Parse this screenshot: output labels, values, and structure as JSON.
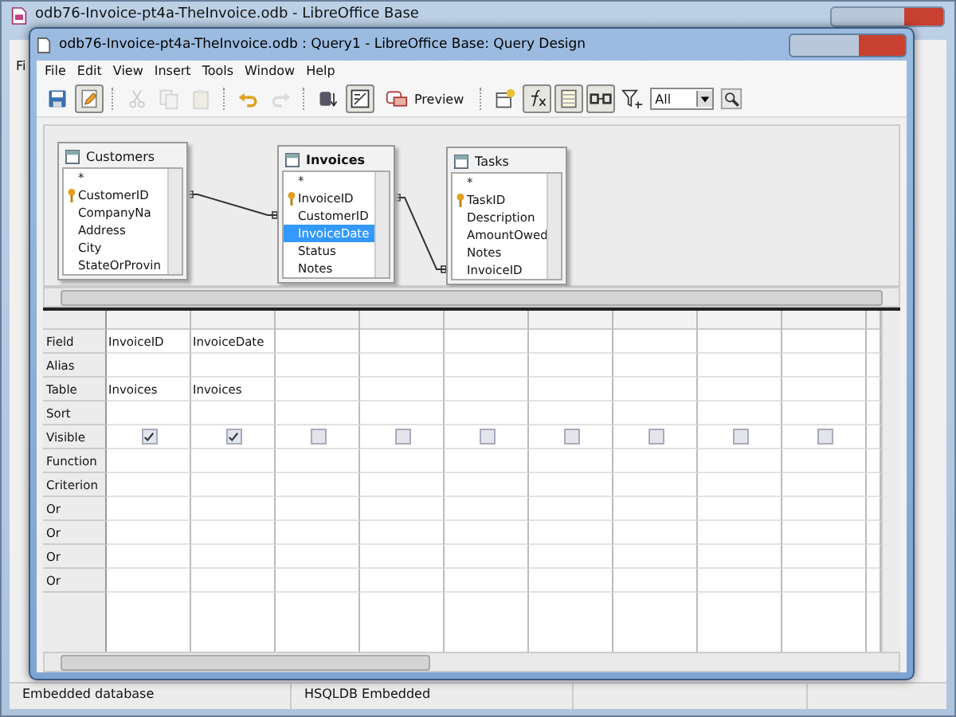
{
  "background_window": {
    "title": "odb76-Invoice-pt4a-TheInvoice.odb - LibreOffice Base",
    "menu_fragment": "Fi"
  },
  "window": {
    "title": "odb76-Invoice-pt4a-TheInvoice.odb : Query1 - LibreOffice Base: Query Design"
  },
  "menu": [
    "File",
    "Edit",
    "View",
    "Insert",
    "Tools",
    "Window",
    "Help"
  ],
  "toolbar": [
    {
      "kind": "icon",
      "pressed": false,
      "disabled": false
    },
    {
      "kind": "icon",
      "pressed": true,
      "disabled": false
    },
    {
      "kind": "separator"
    },
    {
      "kind": "icon",
      "pressed": false,
      "disabled": true
    },
    {
      "kind": "icon",
      "pressed": false,
      "disabled": true
    },
    {
      "kind": "icon",
      "pressed": false,
      "disabled": true
    },
    {
      "kind": "separator"
    },
    {
      "kind": "icon",
      "pressed": false,
      "disabled": false
    },
    {
      "kind": "icon",
      "pressed": false,
      "disabled": true
    },
    {
      "kind": "separator"
    },
    {
      "kind": "icon",
      "pressed": false,
      "disabled": false
    },
    {
      "kind": "icon",
      "pressed": true,
      "disabled": false
    },
    {
      "kind": "text_button",
      "label": "Preview"
    },
    {
      "kind": "separator"
    },
    {
      "kind": "icon",
      "pressed": false,
      "disabled": false
    },
    {
      "kind": "icon",
      "pressed": true,
      "disabled": false
    },
    {
      "kind": "icon",
      "pressed": true,
      "disabled": false
    },
    {
      "kind": "icon",
      "pressed": true,
      "disabled": false
    },
    {
      "kind": "icon",
      "pressed": false,
      "disabled": false
    },
    {
      "kind": "dropdown",
      "value": "All"
    },
    {
      "kind": "icon",
      "pressed": false,
      "disabled": false
    }
  ],
  "tables": [
    {
      "title": "Customers",
      "fields": [
        {
          "name": "*",
          "key": false,
          "selected": false
        },
        {
          "name": "CustomerID",
          "key": true,
          "selected": false
        },
        {
          "name": "CompanyNa",
          "key": false,
          "selected": false
        },
        {
          "name": "Address",
          "key": false,
          "selected": false
        },
        {
          "name": "City",
          "key": false,
          "selected": false
        },
        {
          "name": "StateOrProvin",
          "key": false,
          "selected": false
        }
      ]
    },
    {
      "title": "Invoices",
      "fields": [
        {
          "name": "*",
          "key": false,
          "selected": false
        },
        {
          "name": "InvoiceID",
          "key": true,
          "selected": false
        },
        {
          "name": "CustomerID",
          "key": false,
          "selected": false
        },
        {
          "name": "InvoiceDate",
          "key": false,
          "selected": true
        },
        {
          "name": "Status",
          "key": false,
          "selected": false
        },
        {
          "name": "Notes",
          "key": false,
          "selected": false
        }
      ]
    },
    {
      "title": "Tasks",
      "fields": [
        {
          "name": "*",
          "key": false,
          "selected": false
        },
        {
          "name": "TaskID",
          "key": true,
          "selected": false
        },
        {
          "name": "Description",
          "key": false,
          "selected": false
        },
        {
          "name": "AmountOwed",
          "key": false,
          "selected": false
        },
        {
          "name": "Notes",
          "key": false,
          "selected": false
        },
        {
          "name": "InvoiceID",
          "key": false,
          "selected": false
        }
      ]
    }
  ],
  "grid": {
    "row_labels": [
      "Field",
      "Alias",
      "Table",
      "Sort",
      "Visible",
      "Function",
      "Criterion",
      "Or",
      "Or",
      "Or",
      "Or"
    ],
    "columns": [
      {
        "field": "InvoiceID",
        "table": "Invoices",
        "visible": true
      },
      {
        "field": "InvoiceDate",
        "table": "Invoices",
        "visible": true
      },
      {
        "visible": false
      },
      {
        "visible": false
      },
      {
        "visible": false
      },
      {
        "visible": false
      },
      {
        "visible": false
      },
      {
        "visible": false
      },
      {
        "visible": false
      }
    ]
  },
  "status_bar": [
    "Embedded database",
    "HSQLDB Embedded"
  ]
}
